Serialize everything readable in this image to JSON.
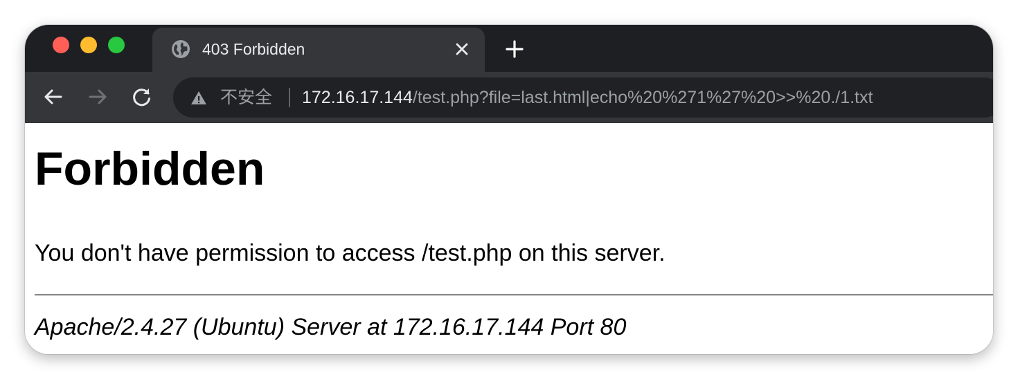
{
  "browser": {
    "tab": {
      "title": "403 Forbidden",
      "icon": "globe-icon"
    },
    "toolbar": {
      "security_label": "不安全",
      "url_host": "172.16.17.144",
      "url_path": "/test.php?file=last.html|echo%20%271%27%20>>%20./1.txt"
    }
  },
  "page": {
    "heading": "Forbidden",
    "message": "You don't have permission to access /test.php on this server.",
    "address": "Apache/2.4.27 (Ubuntu) Server at 172.16.17.144 Port 80"
  },
  "colors": {
    "tabbar": "#1e1f22",
    "toolbar": "#35363a",
    "omnibox": "#202124",
    "traffic_close": "#ff5f57",
    "traffic_minimize": "#febc2e",
    "traffic_maximize": "#28c840"
  }
}
